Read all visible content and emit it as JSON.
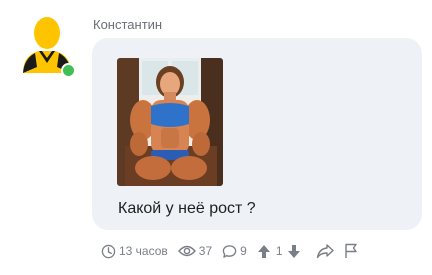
{
  "comment": {
    "author": "Константин",
    "author_online": true,
    "text": "Какой у неё рост ?",
    "image": {
      "alt": "photo-attachment"
    }
  },
  "meta": {
    "time": "13 часов",
    "views": "37",
    "replies": "9",
    "rating": "1"
  },
  "colors": {
    "bubble": "#eef1f6",
    "online": "#3fbf55",
    "meta_text": "#7a7f87",
    "avatar_yellow": "#ffc400"
  },
  "icons": {
    "time": "clock-icon",
    "views": "eye-icon",
    "replies": "comment-icon",
    "upvote": "arrow-up-icon",
    "downvote": "arrow-down-icon",
    "share": "share-icon",
    "report": "flag-icon"
  }
}
